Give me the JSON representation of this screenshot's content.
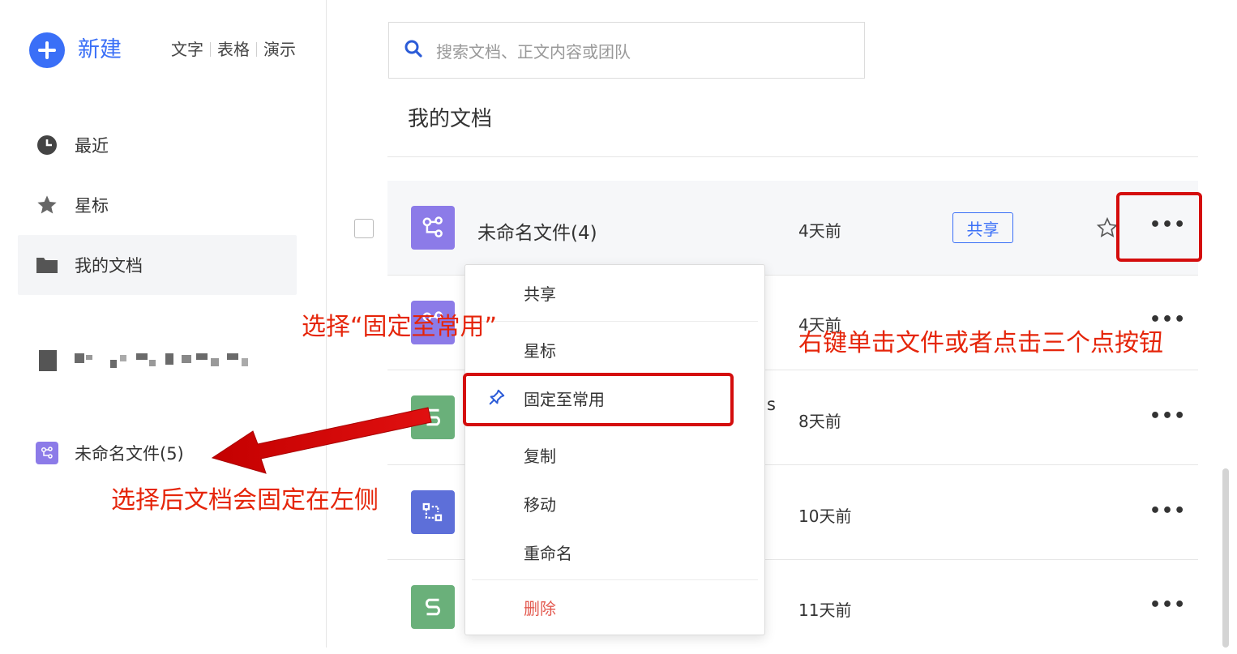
{
  "sidebar": {
    "new_label": "新建",
    "quick_create": [
      "文字",
      "表格",
      "演示"
    ],
    "nav": [
      {
        "label": "最近",
        "icon": "clock-icon"
      },
      {
        "label": "星标",
        "icon": "star-icon"
      },
      {
        "label": "我的文档",
        "icon": "folder-icon"
      }
    ],
    "pinned_file": "未命名文件(5)"
  },
  "search": {
    "placeholder": "搜索文档、正文内容或团队"
  },
  "main": {
    "title": "我的文档",
    "files": [
      {
        "name": "未命名文件(4)",
        "time": "4天前",
        "share": "共享",
        "icon": "mindmap-icon"
      },
      {
        "name": "",
        "time": "4天前",
        "icon": "mindmap-icon"
      },
      {
        "name": "s",
        "time": "8天前",
        "icon": "sheet-icon"
      },
      {
        "name": "",
        "time": "10天前",
        "icon": "flowchart-icon"
      },
      {
        "name": "",
        "time": "11天前",
        "icon": "sheet-icon"
      }
    ],
    "more": "•••"
  },
  "context_menu": {
    "items": [
      "共享",
      "星标",
      "固定至常用",
      "复制",
      "移动",
      "重命名"
    ],
    "delete": "删除"
  },
  "annotations": {
    "pin_hint": "选择“固定至常用”",
    "click_hint": "右键单击文件或者点击三个点按钮",
    "result_hint": "选择后文档会固定在左侧"
  },
  "colors": {
    "accent": "#3a6ff7",
    "annotation": "#e5250a",
    "danger": "#e35a50"
  }
}
